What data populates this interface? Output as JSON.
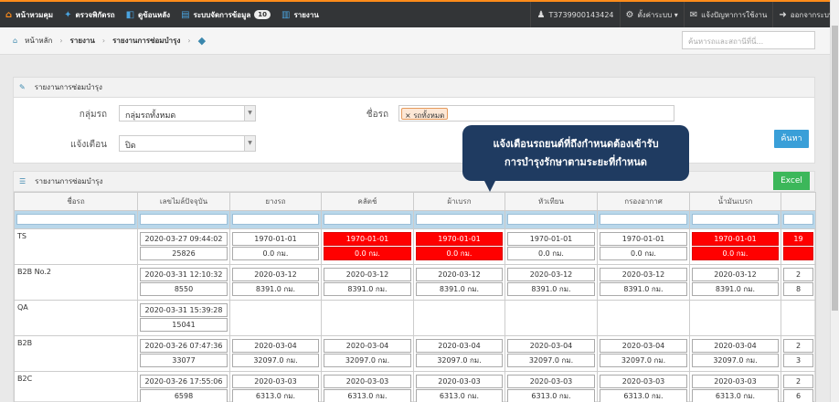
{
  "topnav": {
    "items": [
      {
        "label": "หน้าหวมคุม",
        "icon": "home-icon"
      },
      {
        "label": "ตรวจพิกัดรถ",
        "icon": "location-icon"
      },
      {
        "label": "ดูข้อนหลัง",
        "icon": "history-icon"
      },
      {
        "label": "ระบบจัดการข้อมูล",
        "icon": "database-icon",
        "badge": "10"
      },
      {
        "label": "รายงาน",
        "icon": "report-icon"
      }
    ],
    "right": [
      {
        "label": "T3739900143424",
        "icon": "user-icon"
      },
      {
        "label": "ตั้งค่าระบบ ▾",
        "icon": "gear-icon"
      },
      {
        "label": "แจ้งปัญหาการใช้งาน",
        "icon": "mail-icon"
      },
      {
        "label": "ออกจากระบบ",
        "icon": "logout-icon"
      }
    ]
  },
  "breadcrumb": {
    "home": "หน้าหลัก",
    "level1": "รายงาน",
    "level2": "รายงานการซ่อมบำรุง"
  },
  "search": {
    "placeholder": "ค้นหารถและสถานีที่นี่..."
  },
  "filter_panel": {
    "title": "รายงานการซ่อมบำรุง",
    "group_label": "กลุ่มรถ",
    "group_value": "กลุ่มรถทั้งหมด",
    "vehicle_label": "ชื่อรถ",
    "vehicle_chip": "× รถทั้งหมด",
    "alert_label": "แจ้งเตือน",
    "alert_value": "ปิด",
    "search_button": "ค้นหา"
  },
  "tooltip": {
    "line1": "แจ้งเตือนรถยนต์ที่ถึงกำหนดต้องเข้ารับ",
    "line2": "การบำรุงรักษาตามระยะที่กำหนด"
  },
  "report_panel": {
    "title": "รายงานการซ่อมบำรุง",
    "excel_button": "Excel"
  },
  "colors": {
    "alert_red": "#ff0000",
    "top_accent": "#ff8c1a",
    "header_bg": "#333537",
    "tooltip_bg": "#1f3b61"
  },
  "table": {
    "headers": [
      "ชื่อรถ",
      "เลขไมล์ปัจจุบัน",
      "ยางรถ",
      "คลัตช์",
      "ผ้าเบรก",
      "หัวเทียน",
      "กรองอากาศ",
      "น้ำมันเบรก",
      ""
    ],
    "rows": [
      {
        "name": "TS",
        "mileage": [
          "2020-03-27 09:44:02",
          "25826"
        ],
        "cells": [
          [
            "1970-01-01",
            "0.0 กม.",
            false
          ],
          [
            "1970-01-01",
            "0.0 กม.",
            true
          ],
          [
            "1970-01-01",
            "0.0 กม.",
            true
          ],
          [
            "1970-01-01",
            "0.0 กม.",
            false
          ],
          [
            "1970-01-01",
            "0.0 กม.",
            false
          ],
          [
            "1970-01-01",
            "0.0 กม.",
            true
          ],
          [
            "19",
            "",
            true
          ]
        ]
      },
      {
        "name": "B2B No.2",
        "mileage": [
          "2020-03-31 12:10:32",
          "8550"
        ],
        "cells": [
          [
            "2020-03-12",
            "8391.0 กม.",
            false
          ],
          [
            "2020-03-12",
            "8391.0 กม.",
            false
          ],
          [
            "2020-03-12",
            "8391.0 กม.",
            false
          ],
          [
            "2020-03-12",
            "8391.0 กม.",
            false
          ],
          [
            "2020-03-12",
            "8391.0 กม.",
            false
          ],
          [
            "2020-03-12",
            "8391.0 กม.",
            false
          ],
          [
            "2",
            "8",
            false
          ]
        ]
      },
      {
        "name": "QA",
        "mileage": [
          "2020-03-31 15:39:28",
          "15041"
        ],
        "cells": []
      },
      {
        "name": "B2B",
        "mileage": [
          "2020-03-26 07:47:36",
          "33077"
        ],
        "cells": [
          [
            "2020-03-04",
            "32097.0 กม.",
            false
          ],
          [
            "2020-03-04",
            "32097.0 กม.",
            false
          ],
          [
            "2020-03-04",
            "32097.0 กม.",
            false
          ],
          [
            "2020-03-04",
            "32097.0 กม.",
            false
          ],
          [
            "2020-03-04",
            "32097.0 กม.",
            false
          ],
          [
            "2020-03-04",
            "32097.0 กม.",
            false
          ],
          [
            "2",
            "3",
            false
          ]
        ]
      },
      {
        "name": "B2C",
        "mileage": [
          "2020-03-26 17:55:06",
          "6598"
        ],
        "cells": [
          [
            "2020-03-03",
            "6313.0 กม.",
            false
          ],
          [
            "2020-03-03",
            "6313.0 กม.",
            false
          ],
          [
            "2020-03-03",
            "6313.0 กม.",
            false
          ],
          [
            "2020-03-03",
            "6313.0 กม.",
            false
          ],
          [
            "2020-03-03",
            "6313.0 กม.",
            false
          ],
          [
            "2020-03-03",
            "6313.0 กม.",
            false
          ],
          [
            "2",
            "6",
            false
          ]
        ]
      }
    ]
  }
}
